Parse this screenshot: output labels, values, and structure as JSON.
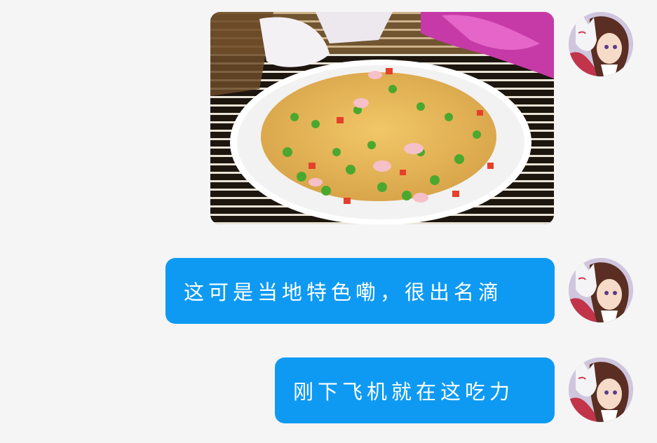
{
  "chat": {
    "messages": [
      {
        "type": "image",
        "subject": "fried-rice-photo"
      },
      {
        "type": "text",
        "text": "这可是当地特色嘞，很出名滴"
      },
      {
        "type": "text",
        "text": "刚下飞机就在这吃力"
      }
    ]
  },
  "colors": {
    "page_background": "#f5f5f5",
    "bubble_background": "#0e9af2",
    "bubble_text": "#ffffff"
  },
  "icons": {
    "avatar": "anime-girl-fox-mask-avatar"
  }
}
